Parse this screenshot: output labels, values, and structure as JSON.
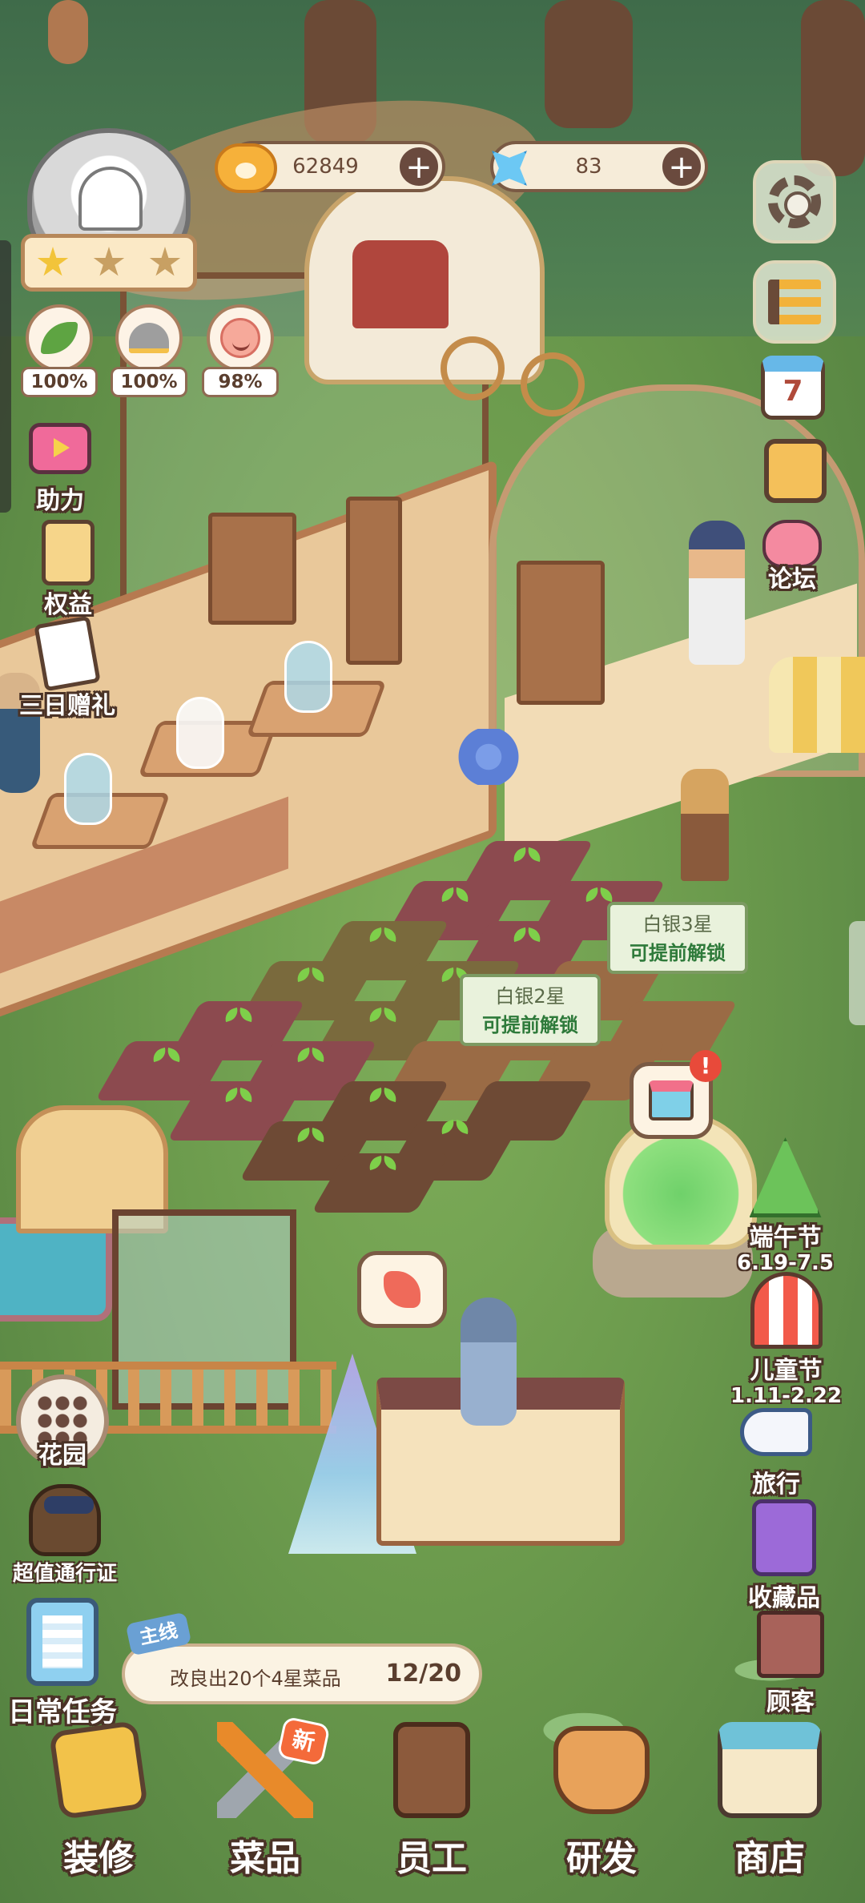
{
  "currency": {
    "coins": {
      "icon": "paw-coin-icon",
      "value": "62849"
    },
    "gems": {
      "icon": "blue-star-gem-icon",
      "value": "83"
    },
    "plus": "+"
  },
  "chef_level": {
    "icon": "chef-hat-icon",
    "stars_filled": 1,
    "stars_total": 3
  },
  "stats": [
    {
      "icon": "leaf-icon",
      "value": "100%"
    },
    {
      "icon": "service-bell-icon",
      "value": "100%"
    },
    {
      "icon": "smiley-icon",
      "value": "98%"
    }
  ],
  "left_menu": {
    "assist": "助力",
    "rights": "权益",
    "three_day_gift": "三日赠礼"
  },
  "right_menu": {
    "settings_icon": "gear-icon",
    "list_icon": "list-icon",
    "calendar_day": "7",
    "album_icon": "photo-album-icon",
    "forum": "论坛"
  },
  "events": {
    "dragon_boat": {
      "label": "端午节",
      "dates": "6.19-7.5"
    },
    "childrens_day": {
      "label": "儿童节",
      "dates": "1.11-2.22"
    },
    "travel": "旅行",
    "collectibles": "收藏品",
    "customers": "顾客"
  },
  "garden": {
    "label": "花园"
  },
  "pass": {
    "label": "超值通行证"
  },
  "daily_tasks": {
    "label": "日常任务"
  },
  "quest": {
    "tag": "主线",
    "text": "改良出20个4星菜品",
    "progress": "12/20"
  },
  "signs": [
    {
      "line1": "白银3星",
      "line2": "可提前解锁"
    },
    {
      "line1": "白银2星",
      "line2": "可提前解锁"
    }
  ],
  "bottom_nav": [
    {
      "label": "装修",
      "icon": "hammer-icon",
      "badge": ""
    },
    {
      "label": "菜品",
      "icon": "fork-spoon-icon",
      "badge": "新"
    },
    {
      "label": "员工",
      "icon": "staff-card-icon",
      "badge": ""
    },
    {
      "label": "研发",
      "icon": "cooking-pot-icon",
      "badge": ""
    },
    {
      "label": "商店",
      "icon": "shop-icon",
      "badge": ""
    }
  ],
  "colors": {
    "outline": "#4a3226",
    "coin": "#f6b13a",
    "gem": "#6cc8f4",
    "lawn": "#6c9b4d",
    "new_badge": "#f46a3a"
  }
}
